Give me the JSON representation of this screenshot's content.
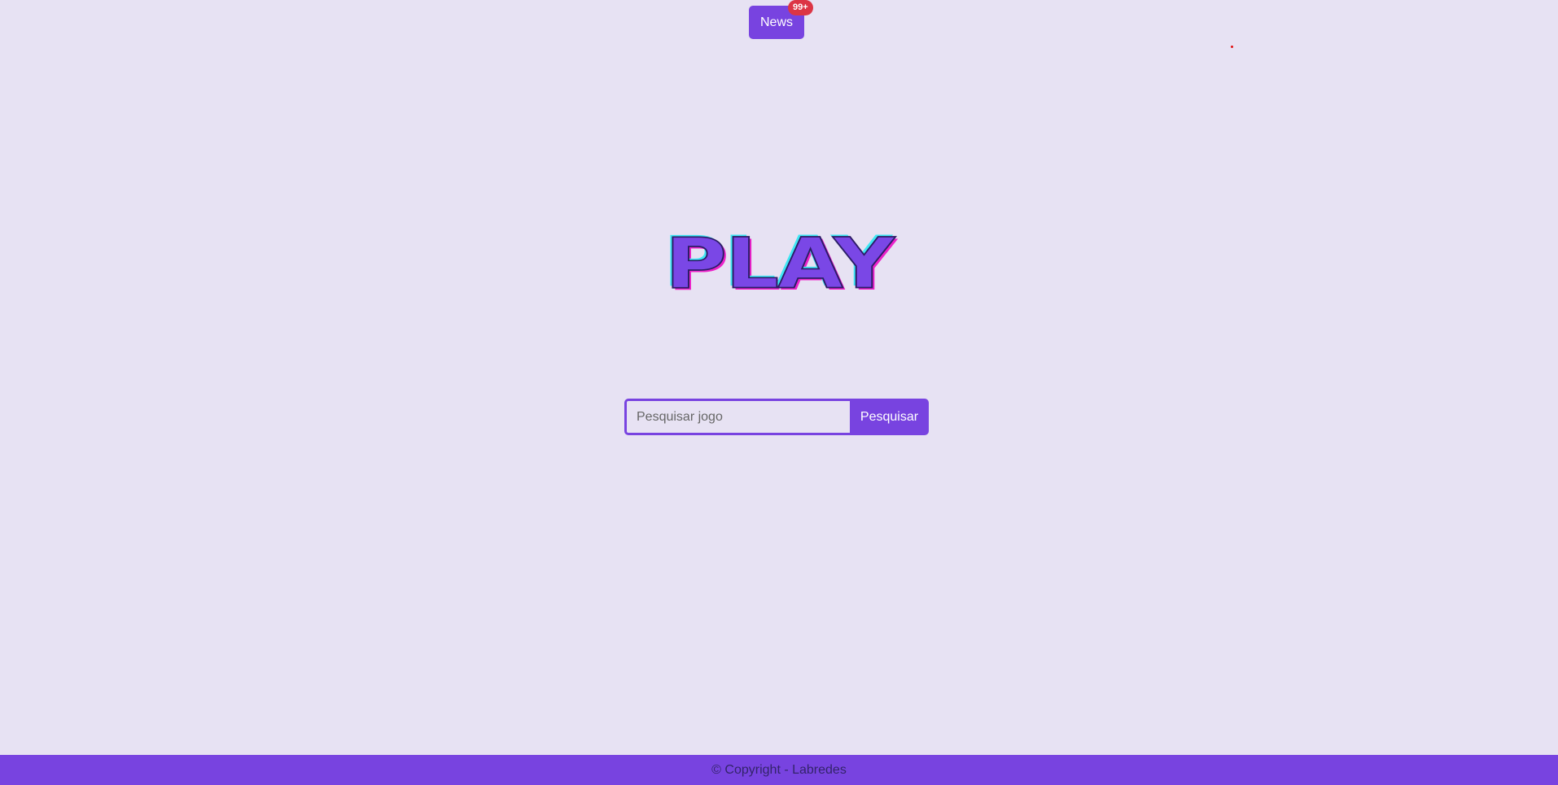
{
  "header": {
    "news_label": "News",
    "news_badge": "99+"
  },
  "logo": {
    "text": "PLAY"
  },
  "search": {
    "placeholder": "Pesquisar jogo",
    "value": "",
    "button_label": "Pesquisar"
  },
  "footer": {
    "copyright": "© Copyright - Labredes"
  },
  "colors": {
    "background": "#e7e2f3",
    "accent": "#7843e0",
    "badge": "#dc3545",
    "logo_cyan": "#3fe7f4",
    "logo_magenta": "#ec22c9"
  }
}
